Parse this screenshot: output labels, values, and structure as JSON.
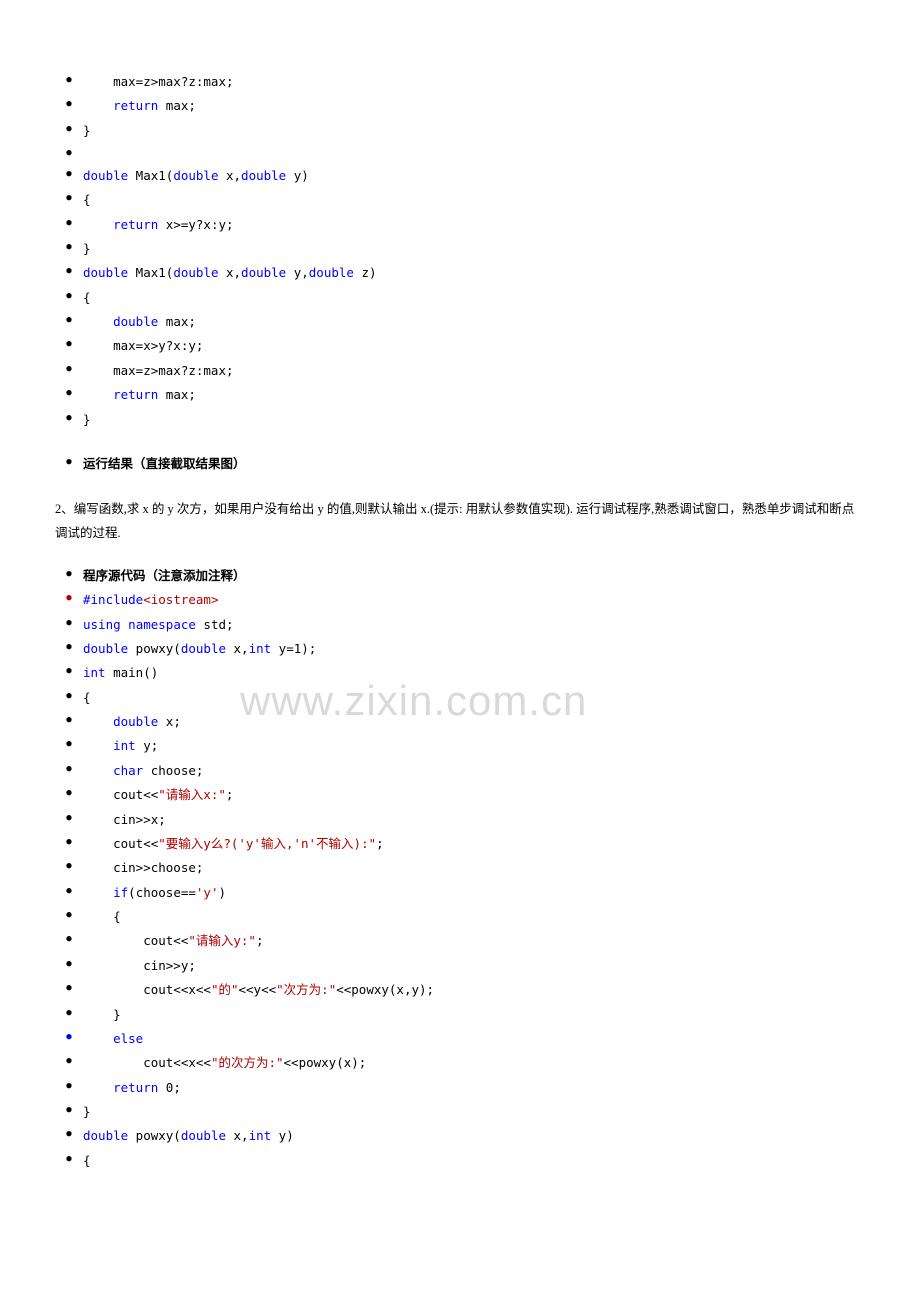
{
  "watermark": "www.zixin.com.cn",
  "block1": {
    "lines": [
      {
        "html": "    max=z>max?z:max;"
      },
      {
        "html": "    <span class='kw'>return</span> max;"
      },
      {
        "html": "}"
      },
      {
        "html": ""
      },
      {
        "html": "<span class='kw'>double</span> Max1(<span class='kw'>double</span> x,<span class='kw'>double</span> y)"
      },
      {
        "html": "{"
      },
      {
        "html": "    <span class='kw'>return</span> x>=y?x:y;"
      },
      {
        "html": "}"
      },
      {
        "html": "<span class='kw'>double</span> Max1(<span class='kw'>double</span> x,<span class='kw'>double</span> y,<span class='kw'>double</span> z)"
      },
      {
        "html": "{"
      },
      {
        "html": "    <span class='kw'>double</span> max;"
      },
      {
        "html": "    max=x>y?x:y;"
      },
      {
        "html": "    max=z>max?z:max;"
      },
      {
        "html": "    <span class='kw'>return</span> max;"
      },
      {
        "html": "}"
      }
    ]
  },
  "heading1": "运行结果（直接截取结果图）",
  "paragraph2": "2、编写函数,求 x 的 y 次方，如果用户没有给出 y 的值,则默认输出 x.(提示: 用默认参数值实现). 运行调试程序,熟悉调试窗口，熟悉单步调试和断点调试的过程.",
  "heading2": "程序源代码（注意添加注释）",
  "block2": {
    "lines": [
      {
        "bullet": "red",
        "html": "<span class='kw'>#include</span><span class='red'>&lt;iostream&gt;</span>"
      },
      {
        "html": "<span class='kw'>using</span> <span class='kw'>namespace</span> std;"
      },
      {
        "html": "<span class='kw'>double</span> powxy(<span class='kw'>double</span> x,<span class='kw'>int</span> y=1);"
      },
      {
        "html": "<span class='kw'>int</span> main()"
      },
      {
        "html": "{"
      },
      {
        "html": "    <span class='kw'>double</span> x;"
      },
      {
        "html": "    <span class='kw'>int</span> y;"
      },
      {
        "html": "    <span class='kw'>char</span> choose;"
      },
      {
        "html": "    cout&lt;&lt;<span class='red'>\"请输入x:\"</span>;"
      },
      {
        "html": "    cin&gt;&gt;x;"
      },
      {
        "html": "    cout&lt;&lt;<span class='red'>\"要输入y么?('y'输入,'n'不输入):\"</span>;"
      },
      {
        "html": "    cin&gt;&gt;choose;"
      },
      {
        "html": "    <span class='kw'>if</span>(choose==<span class='red'>'y'</span>)"
      },
      {
        "html": "    {"
      },
      {
        "html": "        cout&lt;&lt;<span class='red'>\"请输入y:\"</span>;"
      },
      {
        "html": "        cin&gt;&gt;y;"
      },
      {
        "html": "        cout&lt;&lt;x&lt;&lt;<span class='red'>\"的\"</span>&lt;&lt;y&lt;&lt;<span class='red'>\"次方为:\"</span>&lt;&lt;powxy(x,y);"
      },
      {
        "html": "    }"
      },
      {
        "bullet": "blue",
        "html": "    <span class='kw'>else</span>"
      },
      {
        "html": "        cout&lt;&lt;x&lt;&lt;<span class='red'>\"的次方为:\"</span>&lt;&lt;powxy(x);"
      },
      {
        "html": "    <span class='kw'>return</span> 0;"
      },
      {
        "html": "}"
      },
      {
        "html": "<span class='kw'>double</span> powxy(<span class='kw'>double</span> x,<span class='kw'>int</span> y)"
      },
      {
        "html": "{"
      }
    ]
  }
}
